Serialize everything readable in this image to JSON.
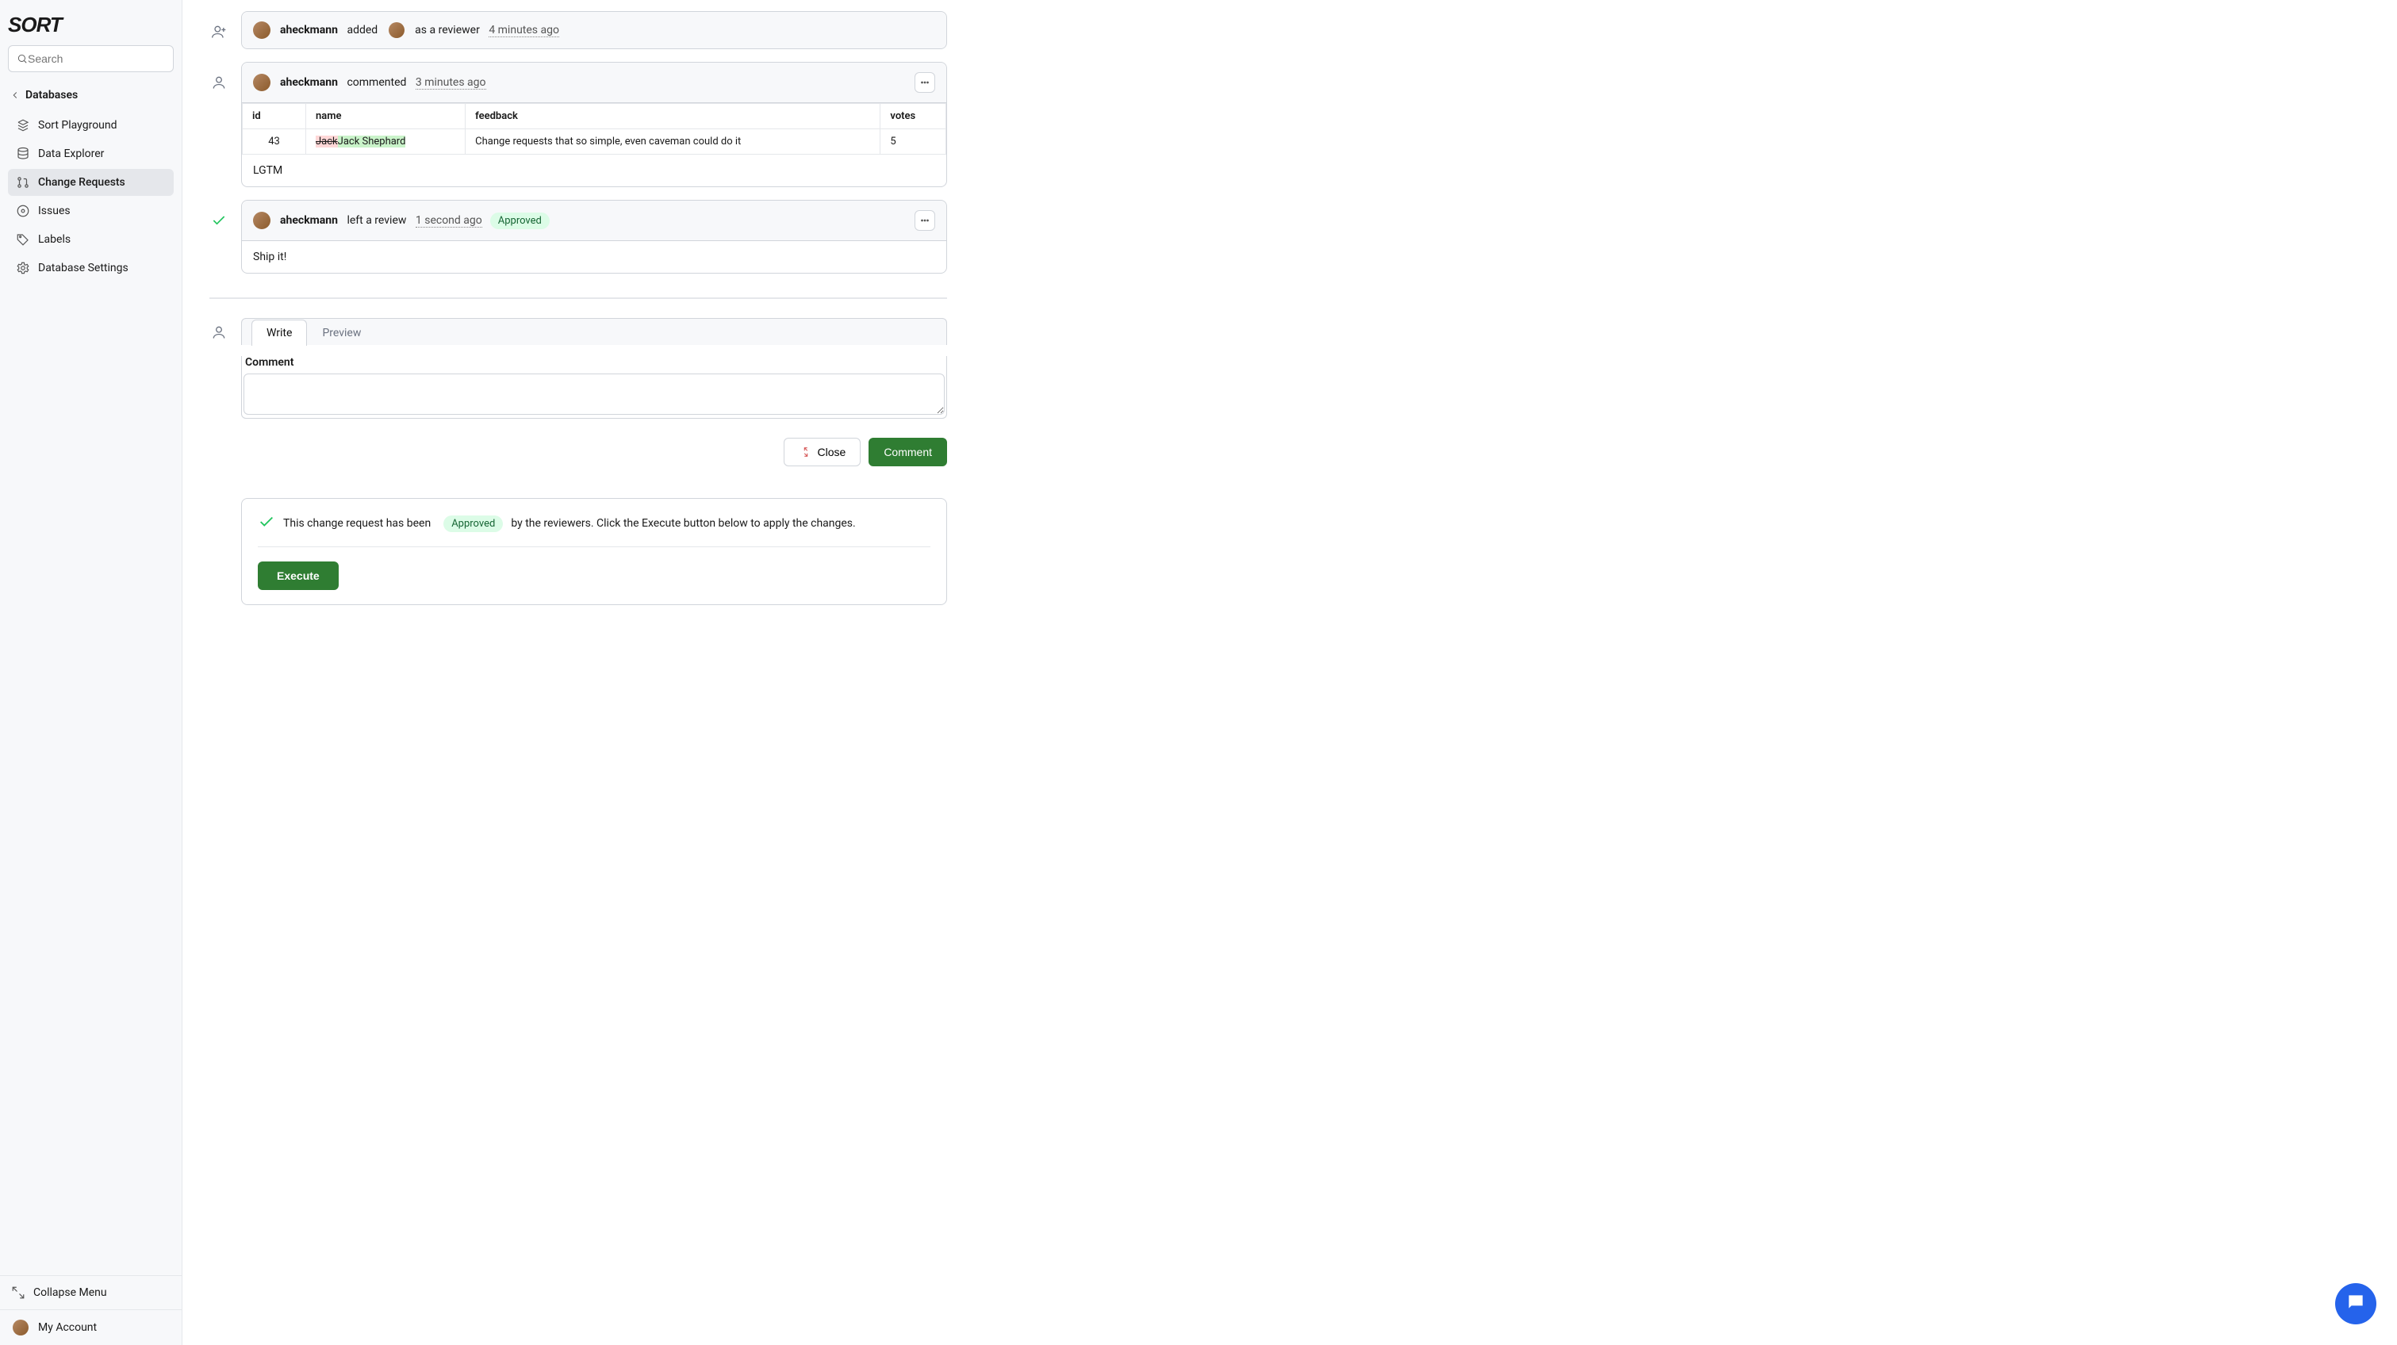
{
  "brand": "SORT",
  "search_placeholder": "Search",
  "back_label": "Databases",
  "nav": [
    {
      "label": "Sort Playground",
      "icon": "stack"
    },
    {
      "label": "Data Explorer",
      "icon": "database"
    },
    {
      "label": "Change Requests",
      "icon": "pull-request",
      "active": true
    },
    {
      "label": "Issues",
      "icon": "issue"
    },
    {
      "label": "Labels",
      "icon": "tag"
    },
    {
      "label": "Database Settings",
      "icon": "gear"
    }
  ],
  "collapse_label": "Collapse Menu",
  "account_label": "My Account",
  "events": {
    "added": {
      "actor": "aheckmann",
      "verb": "added",
      "suffix": "as a reviewer",
      "time": "4 minutes ago"
    },
    "commented": {
      "actor": "aheckmann",
      "verb": "commented",
      "time": "3 minutes ago",
      "body": "LGTM",
      "table": {
        "headers": {
          "id": "id",
          "name": "name",
          "feedback": "feedback",
          "votes": "votes"
        },
        "row": {
          "id": "43",
          "name_del": "Jack",
          "name_add": "Jack Shephard",
          "feedback": "Change requests that so simple, even caveman could do it",
          "votes": "5"
        }
      }
    },
    "review": {
      "actor": "aheckmann",
      "verb": "left a review",
      "time": "1 second ago",
      "badge": "Approved",
      "body": "Ship it!"
    }
  },
  "composer": {
    "tab_write": "Write",
    "tab_preview": "Preview",
    "label": "Comment",
    "close": "Close",
    "submit": "Comment"
  },
  "status": {
    "pre": "This change request has been",
    "badge": "Approved",
    "post": "by the reviewers. Click the Execute button below to apply the changes.",
    "execute": "Execute"
  }
}
